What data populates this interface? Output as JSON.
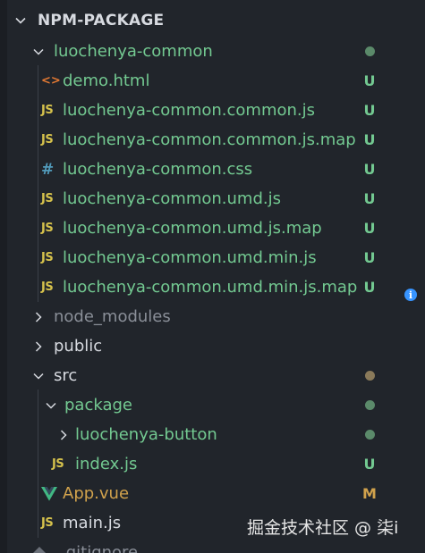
{
  "section": {
    "title": "NPM-PACKAGE"
  },
  "tree": {
    "folder_common": {
      "label": "luochenya-common"
    },
    "files_common": [
      {
        "label": "demo.html",
        "icon": "html-icon",
        "icon_text": "<>",
        "status": "U"
      },
      {
        "label": "luochenya-common.common.js",
        "icon": "js-icon",
        "icon_text": "JS",
        "status": "U"
      },
      {
        "label": "luochenya-common.common.js.map",
        "icon": "js-icon",
        "icon_text": "JS",
        "status": "U"
      },
      {
        "label": "luochenya-common.css",
        "icon": "css-icon",
        "icon_text": "#",
        "status": "U"
      },
      {
        "label": "luochenya-common.umd.js",
        "icon": "js-icon",
        "icon_text": "JS",
        "status": "U"
      },
      {
        "label": "luochenya-common.umd.js.map",
        "icon": "js-icon",
        "icon_text": "JS",
        "status": "U"
      },
      {
        "label": "luochenya-common.umd.min.js",
        "icon": "js-icon",
        "icon_text": "JS",
        "status": "U"
      },
      {
        "label": "luochenya-common.umd.min.js.map",
        "icon": "js-icon",
        "icon_text": "JS",
        "status": "U"
      }
    ],
    "node_modules": {
      "label": "node_modules"
    },
    "public": {
      "label": "public"
    },
    "src": {
      "label": "src"
    },
    "package": {
      "label": "package"
    },
    "luochenya_button": {
      "label": "luochenya-button"
    },
    "index_js": {
      "label": "index.js",
      "icon_text": "JS",
      "status": "U"
    },
    "app_vue": {
      "label": "App.vue",
      "status": "M"
    },
    "main_js": {
      "label": "main.js",
      "icon_text": "JS"
    },
    "gitignore": {
      "label": ".gitignore"
    }
  },
  "info_badge": {
    "text": "i"
  },
  "watermark": {
    "text": "掘金技术社区 @ 柒i"
  },
  "colors": {
    "background": "#21252b",
    "untracked": "#73c991",
    "modified": "#d1a24c",
    "js": "#d6c24c",
    "html": "#e37933",
    "css": "#519aba",
    "vue": "#41b883",
    "info": "#3794ff"
  }
}
